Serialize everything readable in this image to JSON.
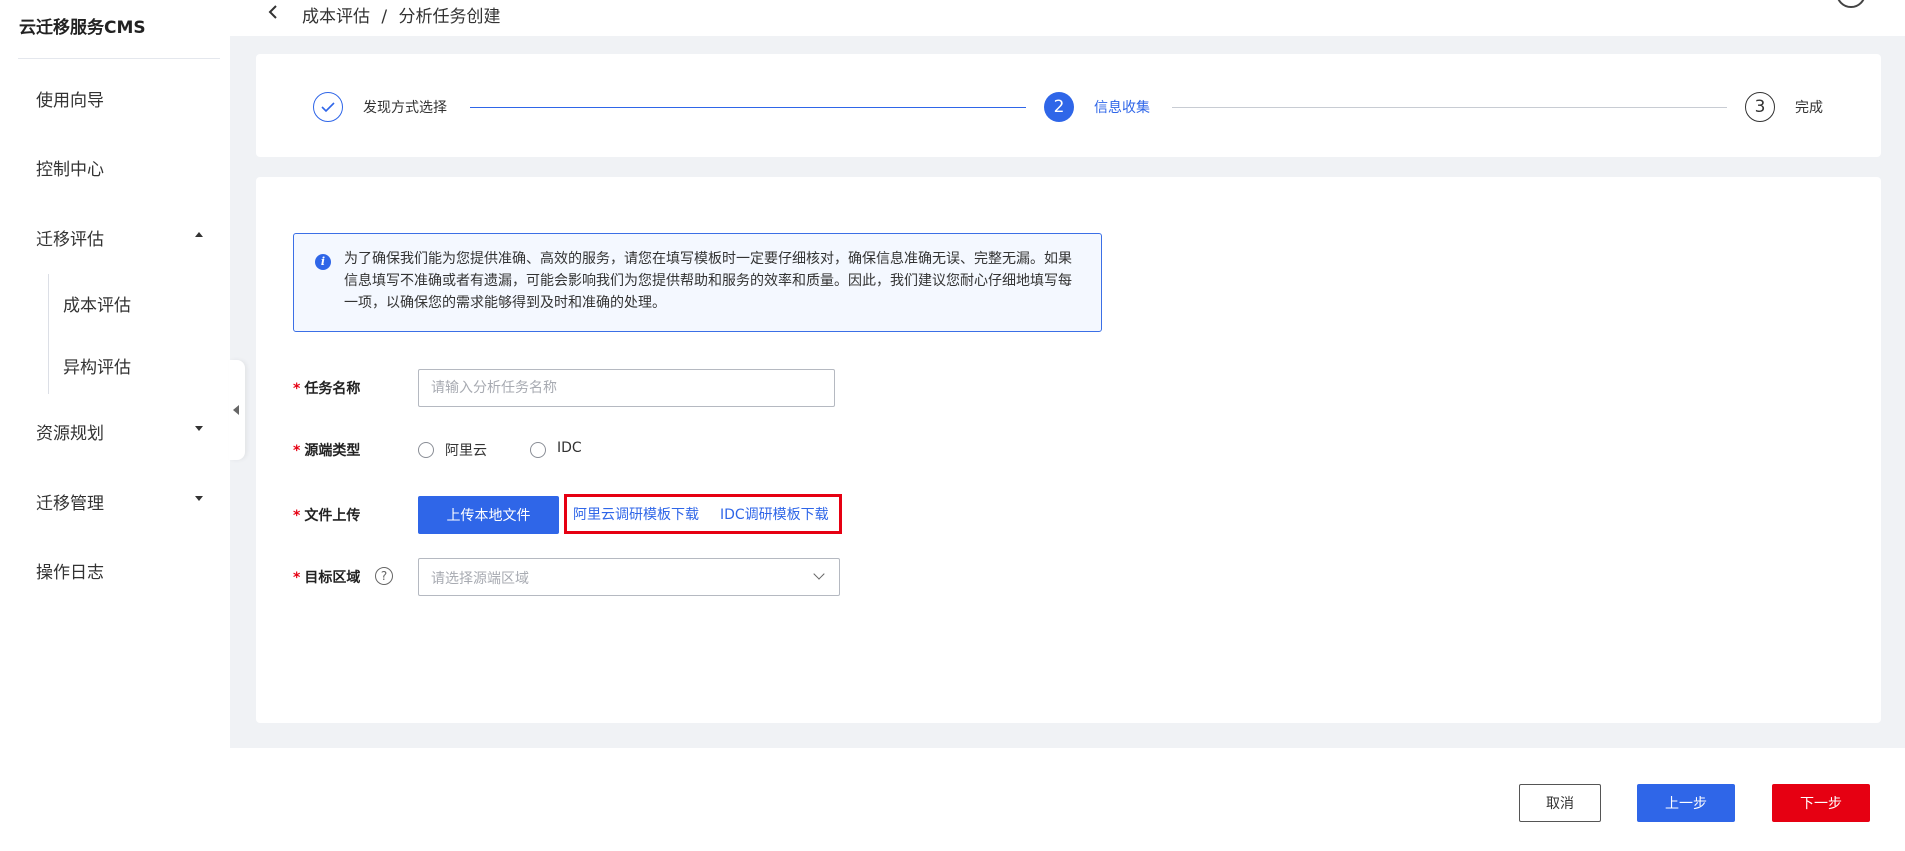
{
  "app": {
    "title": "云迁移服务CMS"
  },
  "sidebar": {
    "items": [
      {
        "label": "使用向导"
      },
      {
        "label": "控制中心"
      },
      {
        "label": "迁移评估",
        "expanded": true,
        "children": [
          {
            "label": "成本评估"
          },
          {
            "label": "异构评估"
          }
        ]
      },
      {
        "label": "资源规划"
      },
      {
        "label": "迁移管理"
      },
      {
        "label": "操作日志"
      }
    ]
  },
  "header": {
    "breadcrumb": [
      "成本评估",
      "/",
      "分析任务创建"
    ]
  },
  "steps": [
    {
      "label": "发现方式选择",
      "status": "done",
      "number": "✓"
    },
    {
      "label": "信息收集",
      "status": "active",
      "number": "2"
    },
    {
      "label": "完成",
      "status": "todo",
      "number": "3"
    }
  ],
  "notice": {
    "text": "为了确保我们能为您提供准确、高效的服务，请您在填写模板时一定要仔细核对，确保信息准确无误、完整无漏。如果信息填写不准确或者有遗漏，可能会影响我们为您提供帮助和服务的效率和质量。因此，我们建议您耐心仔细地填写每一项，以确保您的需求能够得到及时和准确的处理。"
  },
  "form": {
    "required_mark": "*",
    "task_name": {
      "label": "任务名称",
      "placeholder": "请输入分析任务名称",
      "value": ""
    },
    "source_type": {
      "label": "源端类型",
      "options": [
        "阿里云",
        "IDC"
      ]
    },
    "file_upload": {
      "label": "文件上传",
      "button_label": "上传本地文件",
      "template_links": [
        "阿里云调研模板下载",
        "IDC调研模板下载"
      ]
    },
    "target_region": {
      "label": "目标区域",
      "help": "?",
      "placeholder": "请选择源端区域"
    }
  },
  "footer": {
    "cancel_label": "取消",
    "prev_label": "上一步",
    "next_label": "下一步"
  },
  "colors": {
    "primary": "#2f66e8",
    "danger": "#e60012",
    "page_bg": "#f0f2f5"
  }
}
